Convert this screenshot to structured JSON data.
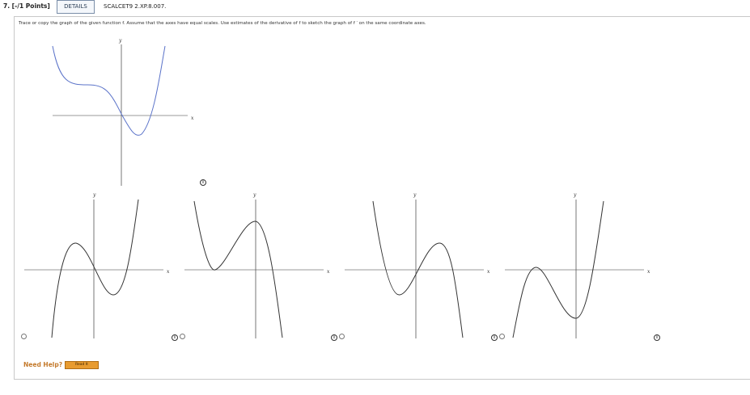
{
  "header": {
    "question_number": "7.  [-/1 Points]",
    "details_label": "DETAILS",
    "question_code": "SCALCET9 2.XP.8.007."
  },
  "instructions": "Trace or copy the graph of the given function f. Assume that the axes have equal scales. Use estimates of the derivative of f to sketch the graph of f ′ on the same coordinate axes.",
  "main_graph": {
    "x_label": "x",
    "y_label": "y",
    "curve_color": "#5b73c9"
  },
  "options": [
    {
      "x_label": "x",
      "y_label": "y"
    },
    {
      "x_label": "x",
      "y_label": "y"
    },
    {
      "x_label": "x",
      "y_label": "y"
    },
    {
      "x_label": "x",
      "y_label": "y"
    }
  ],
  "help": {
    "label": "Need Help?",
    "read_it_label": "Read It"
  },
  "icons": {
    "info": "info-icon",
    "radio": "radio-button"
  }
}
